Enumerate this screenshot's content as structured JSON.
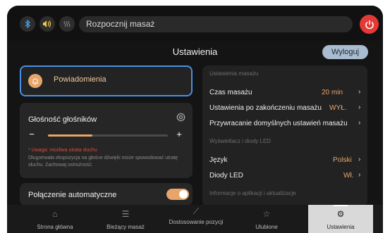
{
  "topbar": {
    "bluetooth_icon": "bluetooth-icon",
    "speaker_icon": "speaker-icon",
    "heat_icon": "heat-icon",
    "start_label": "Rozpocznij masaż",
    "power_icon": "power-icon",
    "power_color": "#e53935"
  },
  "header": {
    "title": "Ustawienia",
    "logout_label": "Wyloguj"
  },
  "notifications": {
    "label": "Powiadomienia",
    "accent": "#e8a56a",
    "border_color": "#4a90e2"
  },
  "volume": {
    "title": "Głośność głośników",
    "level": 0.37,
    "minus": "−",
    "plus": "+",
    "warning": "* Uwaga: możliwa utrata słuchu",
    "note": "Długotrwała ekspozycja na głośne dźwięki może spowodować utratę słuchu. Zachowaj ostrożność."
  },
  "auto_connect": {
    "label": "Połączenie automatyczne",
    "enabled": true
  },
  "settings_panel": {
    "section_massage": "Ustawienia masażu",
    "rows_massage": [
      {
        "label": "Czas masażu",
        "value": "20 min"
      },
      {
        "label": "Ustawienia po zakończeniu masażu",
        "value": "WYŁ."
      },
      {
        "label": "Przywracanie domyślnych ustawień masażu",
        "value": ""
      }
    ],
    "section_display": "Wyświetlacz i diody LED",
    "rows_display": [
      {
        "label": "Język",
        "value": "Polski"
      },
      {
        "label": "Diody LED",
        "value": "Wł."
      }
    ],
    "section_info": "Informacje o aplikacji i aktualizacje"
  },
  "bottom_nav": [
    {
      "label": "Strona główna",
      "icon": "home-icon"
    },
    {
      "label": "Bieżący masaż",
      "icon": "sliders-icon"
    },
    {
      "label": "Dostosowanie pozycji",
      "icon": "recline-icon"
    },
    {
      "label": "Ulubione",
      "icon": "star-icon"
    },
    {
      "label": "Ustawienia",
      "icon": "gear-icon",
      "active": true
    }
  ]
}
